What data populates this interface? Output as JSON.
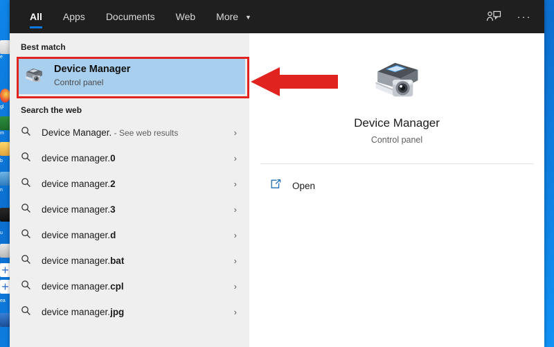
{
  "window": {
    "title": "Windows Search",
    "accent_color": "#0a7ae0",
    "header_bg": "#1f1f1f",
    "left_pane_bg": "#efefef",
    "right_pane_bg": "#ffffff",
    "highlight_color": "#a9cfef",
    "annotation_color": "#e1231f"
  },
  "tabs": [
    {
      "label": "All",
      "active": true,
      "icon": ""
    },
    {
      "label": "Apps",
      "active": false,
      "icon": ""
    },
    {
      "label": "Documents",
      "active": false,
      "icon": ""
    },
    {
      "label": "Web",
      "active": false,
      "icon": ""
    },
    {
      "label": "More",
      "active": false,
      "icon": "chevron-down-icon",
      "caret": "▼"
    }
  ],
  "header_actions": [
    {
      "name": "feedback-icon",
      "label": "Feedback"
    },
    {
      "name": "more-options-icon",
      "label": "···"
    }
  ],
  "best_match": {
    "section_label": "Best match",
    "title": "Device Manager",
    "subtitle": "Control panel",
    "icon": "devices-and-printers-icon",
    "selected": true,
    "annotated": true
  },
  "search_the_web": {
    "section_label": "Search the web",
    "items": [
      {
        "text": "Device Manager.",
        "bold_part": "",
        "suffix": " - See web results",
        "icon": "search-icon",
        "chevron": "›"
      },
      {
        "text": "device manager.",
        "bold_part": "0",
        "suffix": "",
        "icon": "search-icon",
        "chevron": "›"
      },
      {
        "text": "device manager.",
        "bold_part": "2",
        "suffix": "",
        "icon": "search-icon",
        "chevron": "›"
      },
      {
        "text": "device manager.",
        "bold_part": "3",
        "suffix": "",
        "icon": "search-icon",
        "chevron": "›"
      },
      {
        "text": "device manager.",
        "bold_part": "d",
        "suffix": "",
        "icon": "search-icon",
        "chevron": "›"
      },
      {
        "text": "device manager.",
        "bold_part": "bat",
        "suffix": "",
        "icon": "search-icon",
        "chevron": "›"
      },
      {
        "text": "device manager.",
        "bold_part": "cpl",
        "suffix": "",
        "icon": "search-icon",
        "chevron": "›"
      },
      {
        "text": "device manager.",
        "bold_part": "jpg",
        "suffix": "",
        "icon": "search-icon",
        "chevron": "›"
      }
    ]
  },
  "preview": {
    "title": "Device Manager",
    "subtitle": "Control panel",
    "icon": "devices-and-printers-icon",
    "actions": [
      {
        "label": "Open",
        "icon": "open-external-icon"
      }
    ]
  },
  "annotations": {
    "arrow": {
      "direction": "left",
      "color": "#e1231f"
    },
    "box": {
      "color": "#e1231f",
      "target": "best-match-row"
    }
  },
  "desktop": {
    "background_color": "#0f86ea",
    "left_edge_fragments": [
      "e",
      "gl",
      "m",
      "b",
      "n",
      "u",
      "ea"
    ]
  }
}
